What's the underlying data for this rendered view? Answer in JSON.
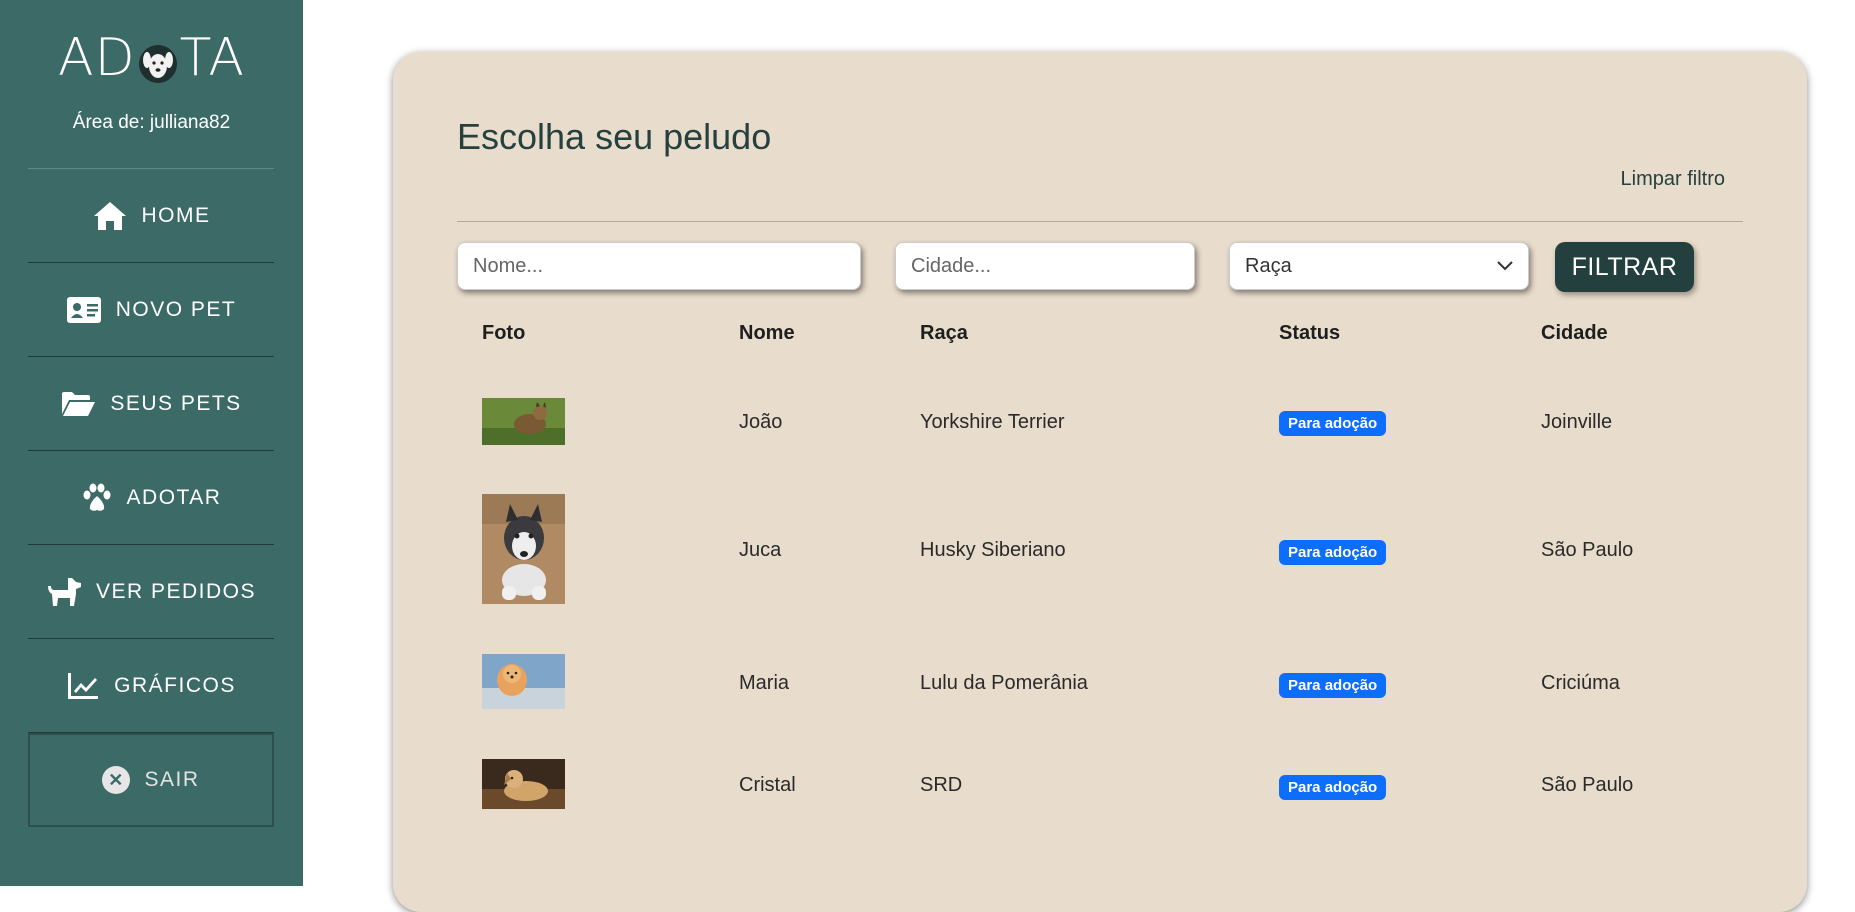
{
  "sidebar": {
    "brand_left": "AD",
    "brand_right": "TA",
    "area_label": "Área de: julliana82",
    "items": [
      {
        "label": "HOME",
        "icon": "home-icon"
      },
      {
        "label": "NOVO PET",
        "icon": "id-card-icon"
      },
      {
        "label": "SEUS PETS",
        "icon": "folder-open-icon"
      },
      {
        "label": "ADOTAR",
        "icon": "paw-icon"
      },
      {
        "label": "VER PEDIDOS",
        "icon": "dog-icon"
      },
      {
        "label": "GRÁFICOS",
        "icon": "chart-line-icon"
      },
      {
        "label": "SAIR",
        "icon": "close-circle-icon"
      }
    ]
  },
  "main": {
    "title": "Escolha seu peludo",
    "clear_filter": "Limpar filtro",
    "filters": {
      "nome_placeholder": "Nome...",
      "cidade_placeholder": "Cidade...",
      "raca_selected": "Raça",
      "button_label": "FILTRAR"
    },
    "table": {
      "headers": [
        "Foto",
        "Nome",
        "Raça",
        "Status",
        "Cidade"
      ],
      "rows": [
        {
          "nome": "João",
          "raca": "Yorkshire Terrier",
          "status": "Para adoção",
          "cidade": "Joinville"
        },
        {
          "nome": "Juca",
          "raca": "Husky Siberiano",
          "status": "Para adoção",
          "cidade": "São Paulo"
        },
        {
          "nome": "Maria",
          "raca": "Lulu da Pomerânia",
          "status": "Para adoção",
          "cidade": "Criciúma"
        },
        {
          "nome": "Cristal",
          "raca": "SRD",
          "status": "Para adoção",
          "cidade": "São Paulo"
        }
      ]
    }
  },
  "colors": {
    "sidebar": "#3c6a67",
    "card": "#e8dccc",
    "button": "#23403e",
    "badge": "#0d6efd"
  }
}
